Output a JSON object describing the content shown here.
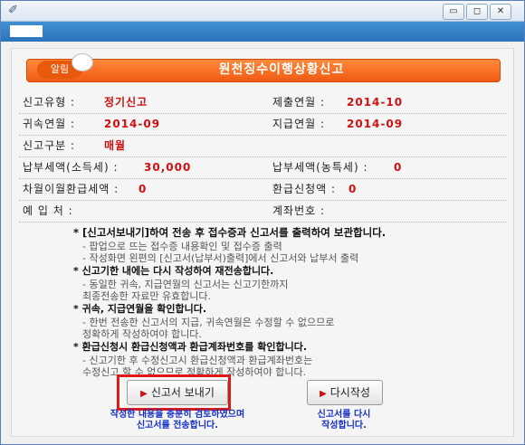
{
  "window": {
    "minimize": "▭",
    "restore": "◻",
    "close": "✕"
  },
  "alert": {
    "badge": "알림",
    "title": "원천징수이행상황신고"
  },
  "fields": {
    "report_type_label": "신고유형 :",
    "report_type_value": "정기신고",
    "submit_month_label": "제출연월 :",
    "submit_month_value": "2014-10",
    "belong_month_label": "귀속연월 :",
    "belong_month_value": "2014-09",
    "pay_month_label": "지급연월 :",
    "pay_month_value": "2014-09",
    "report_class_label": "신고구분 :",
    "report_class_value": "매월",
    "tax_income_label": "납부세액(소득세) :",
    "tax_income_value": "30,000",
    "tax_farm_label": "납부세액(농특세) :",
    "tax_farm_value": "0",
    "carry_refund_label": "차월이월환급세액 :",
    "carry_refund_value": "0",
    "refund_request_label": "환급신청액 :",
    "refund_request_value": "0",
    "deposit_label": "예 입 처 :",
    "account_label": "계좌번호 :"
  },
  "notes": [
    {
      "style": "b",
      "text": "* [신고서보내기]하여 전송 후 접수증과 신고서를 출력하여 보관합니다."
    },
    {
      "style": "g",
      "text": "- 팝업으로 뜨는 접수증 내용확인 및 접수증 출력"
    },
    {
      "style": "g",
      "text": "- 작성화면 왼편의 [신고서(납부서)출력]에서 신고서와 납부서 출력"
    },
    {
      "style": "b",
      "text": "* 신고기한 내에는 다시 작성하여 재전송합니다."
    },
    {
      "style": "g",
      "text": "- 동일한 귀속, 지급연월의 신고서는 신고기한까지"
    },
    {
      "style": "g",
      "text": "  최종전송한 자료만 유효합니다."
    },
    {
      "style": "b",
      "text": "* 귀속, 지급연월을 확인합니다."
    },
    {
      "style": "g",
      "text": "- 한번 전송한 신고서의 지급, 귀속연월은 수정할 수 없으므로"
    },
    {
      "style": "g",
      "text": "  정확하게 작성하여야 합니다."
    },
    {
      "style": "b",
      "text": "* 환급신청시 환급신청액과 환급계좌번호를 확인합니다."
    },
    {
      "style": "g",
      "text": "- 신고기한 후 수정신고시 환급신청액과 환급계좌번호는"
    },
    {
      "style": "g",
      "text": "  수정신고 할 수 없으므로 정확하게 작성하여야 합니다."
    }
  ],
  "buttons": {
    "send_label": "신고서 보내기",
    "redo_label": "다시작성",
    "play_icon": "▶"
  },
  "captions": {
    "send_line1": "작성한 내용을 충분히 검토하였으며",
    "send_line2": "신고서를 전송합니다.",
    "redo_line1": "신고서를 다시",
    "redo_line2": "작성합니다."
  }
}
